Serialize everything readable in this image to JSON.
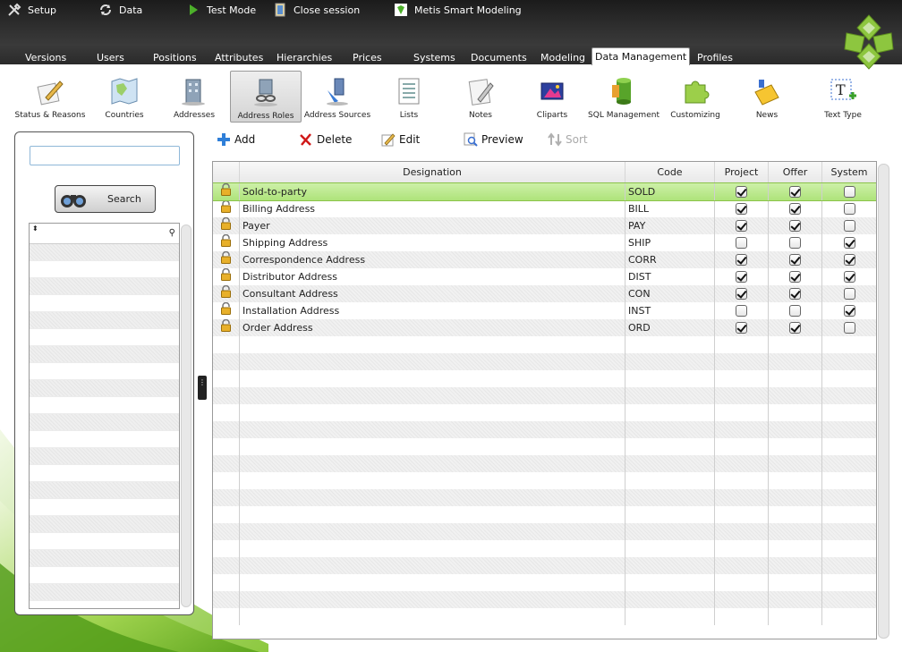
{
  "topmenu": {
    "setup": "Setup",
    "data": "Data",
    "test_mode": "Test Mode",
    "close_session": "Close session",
    "app_name": "Metis Smart Modeling"
  },
  "tabs": [
    "Versions",
    "Users",
    "Positions",
    "Attributes",
    "Hierarchies",
    "Prices",
    "Systems",
    "Documents",
    "Modeling",
    "Data Management",
    "Profiles"
  ],
  "active_tab": "Data Management",
  "toolbar": [
    {
      "label": "Status & Reasons",
      "icon": "pencil-paper-icon"
    },
    {
      "label": "Countries",
      "icon": "map-icon"
    },
    {
      "label": "Addresses",
      "icon": "buildings-icon"
    },
    {
      "label": "Address Roles",
      "icon": "address-roles-icon"
    },
    {
      "label": "Address Sources",
      "icon": "address-sources-icon"
    },
    {
      "label": "Lists",
      "icon": "list-icon"
    },
    {
      "label": "Notes",
      "icon": "notes-icon"
    },
    {
      "label": "Cliparts",
      "icon": "cliparts-icon"
    },
    {
      "label": "SQL Management",
      "icon": "database-icon"
    },
    {
      "label": "Customizing",
      "icon": "puzzle-icon"
    },
    {
      "label": "News",
      "icon": "news-icon"
    },
    {
      "label": "Text Type",
      "icon": "text-type-icon"
    }
  ],
  "active_toolbar": "Address Roles",
  "search": {
    "button_label": "Search",
    "value": ""
  },
  "actions": {
    "add": "Add",
    "delete": "Delete",
    "edit": "Edit",
    "preview": "Preview",
    "sort": "Sort"
  },
  "grid": {
    "columns": [
      "Designation",
      "Code",
      "Project",
      "Offer",
      "System"
    ],
    "rows": [
      {
        "designation": "Sold-to-party",
        "code": "SOLD",
        "project": true,
        "offer": true,
        "system": false
      },
      {
        "designation": "Billing Address",
        "code": "BILL",
        "project": true,
        "offer": true,
        "system": false
      },
      {
        "designation": "Payer",
        "code": "PAY",
        "project": true,
        "offer": true,
        "system": false
      },
      {
        "designation": "Shipping Address",
        "code": "SHIP",
        "project": false,
        "offer": false,
        "system": true
      },
      {
        "designation": "Correspondence Address",
        "code": "CORR",
        "project": true,
        "offer": true,
        "system": true
      },
      {
        "designation": "Distributor Address",
        "code": "DIST",
        "project": true,
        "offer": true,
        "system": true
      },
      {
        "designation": "Consultant Address",
        "code": "CON",
        "project": true,
        "offer": true,
        "system": false
      },
      {
        "designation": "Installation Address",
        "code": "INST",
        "project": false,
        "offer": false,
        "system": true
      },
      {
        "designation": "Order Address",
        "code": "ORD",
        "project": true,
        "offer": true,
        "system": false
      }
    ],
    "selected_row": 0
  },
  "colors": {
    "accent_green": "#8dc63f",
    "selection": "#b5e67e",
    "topbar": "#2a2a2a"
  }
}
